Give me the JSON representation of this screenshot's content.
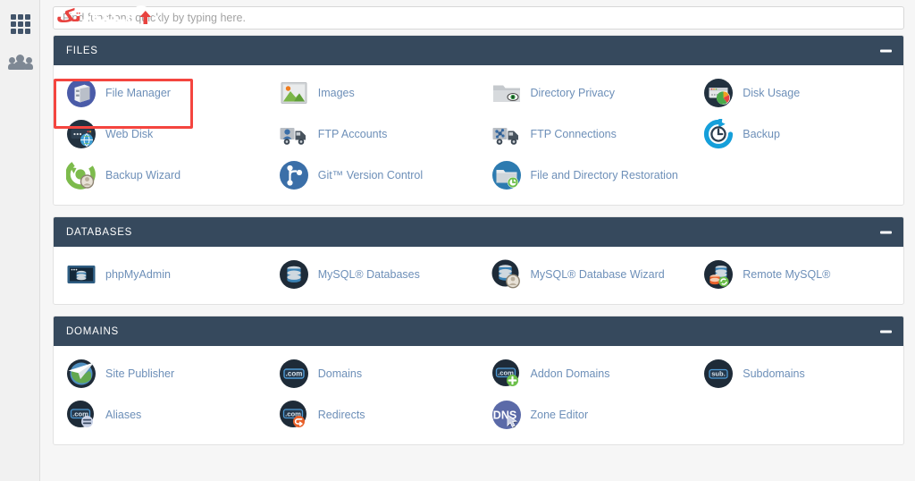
{
  "sidebar": {
    "items": [
      {
        "name": "apps-grid",
        "icon": "grid-icon"
      },
      {
        "name": "user-manager",
        "icon": "users-icon"
      }
    ]
  },
  "search": {
    "placeholder": "Find functions quickly by typing here.",
    "value": ""
  },
  "watermark": {
    "text_red": "تک",
    "text_white": "ـکلود",
    "icon": "cloud-upload-icon"
  },
  "colors": {
    "header_bar": "#36495d",
    "link": "#6d8fb8",
    "highlight": "#f4453f",
    "page_bg": "#f6f6f6",
    "rail_bg": "#f1f1f1"
  },
  "highlight": {
    "target": "File Manager",
    "color": "#f4453f"
  },
  "sections": [
    {
      "title": "FILES",
      "collapse_label": "−",
      "items": [
        {
          "label": "File Manager",
          "icon": "file-manager-icon"
        },
        {
          "label": "Images",
          "icon": "images-icon"
        },
        {
          "label": "Directory Privacy",
          "icon": "directory-privacy-icon"
        },
        {
          "label": "Disk Usage",
          "icon": "disk-usage-icon"
        },
        {
          "label": "Web Disk",
          "icon": "web-disk-icon"
        },
        {
          "label": "FTP Accounts",
          "icon": "ftp-accounts-icon"
        },
        {
          "label": "FTP Connections",
          "icon": "ftp-connections-icon"
        },
        {
          "label": "Backup",
          "icon": "backup-icon"
        },
        {
          "label": "Backup Wizard",
          "icon": "backup-wizard-icon"
        },
        {
          "label": "Git™ Version Control",
          "icon": "git-icon"
        },
        {
          "label": "File and Directory Restoration",
          "icon": "file-restore-icon"
        }
      ]
    },
    {
      "title": "DATABASES",
      "collapse_label": "−",
      "items": [
        {
          "label": "phpMyAdmin",
          "icon": "phpmyadmin-icon"
        },
        {
          "label": "MySQL® Databases",
          "icon": "mysql-databases-icon"
        },
        {
          "label": "MySQL® Database Wizard",
          "icon": "mysql-wizard-icon"
        },
        {
          "label": "Remote MySQL®",
          "icon": "remote-mysql-icon"
        }
      ]
    },
    {
      "title": "DOMAINS",
      "collapse_label": "−",
      "items": [
        {
          "label": "Site Publisher",
          "icon": "site-publisher-icon"
        },
        {
          "label": "Domains",
          "icon": "domains-icon"
        },
        {
          "label": "Addon Domains",
          "icon": "addon-domains-icon"
        },
        {
          "label": "Subdomains",
          "icon": "subdomains-icon"
        },
        {
          "label": "Aliases",
          "icon": "aliases-icon"
        },
        {
          "label": "Redirects",
          "icon": "redirects-icon"
        },
        {
          "label": "Zone Editor",
          "icon": "zone-editor-icon"
        }
      ]
    }
  ]
}
